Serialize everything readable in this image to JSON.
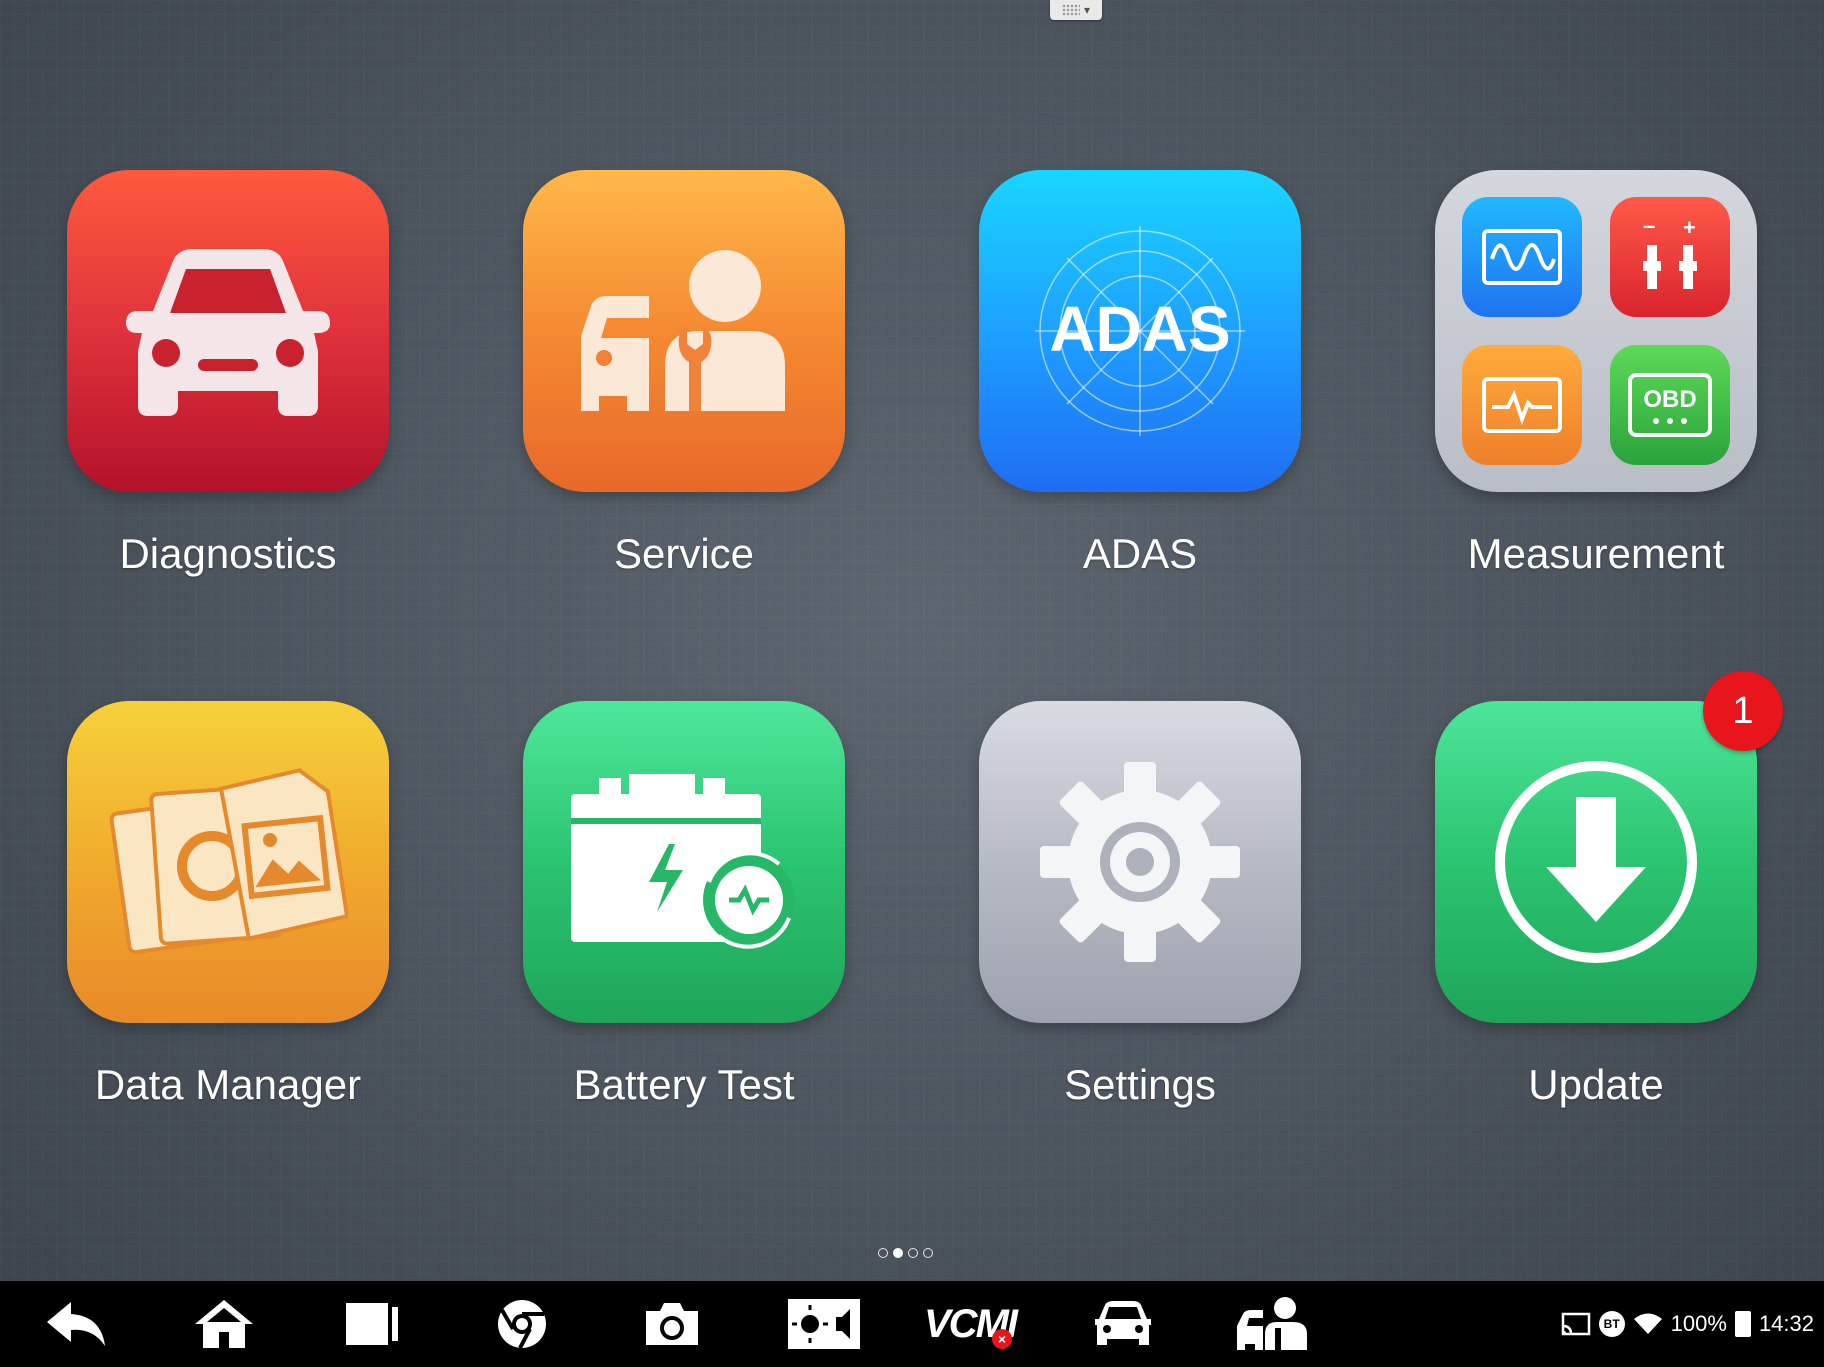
{
  "apps": {
    "diagnostics": {
      "label": "Diagnostics",
      "icon": "car-front-icon"
    },
    "service": {
      "label": "Service",
      "icon": "service-technician-icon"
    },
    "adas": {
      "label": "ADAS",
      "icon": "adas-icon",
      "icon_text": "ADAS"
    },
    "measurement": {
      "label": "Measurement",
      "icon": "measurement-folder-icon",
      "obd_text": "OBD"
    },
    "data_manager": {
      "label": "Data Manager",
      "icon": "data-manager-icon"
    },
    "battery_test": {
      "label": "Battery Test",
      "icon": "battery-test-icon"
    },
    "settings": {
      "label": "Settings",
      "icon": "gear-icon"
    },
    "update": {
      "label": "Update",
      "icon": "download-icon",
      "badge": "1"
    }
  },
  "pager": {
    "pages": 4,
    "active": 1
  },
  "taskbar": {
    "items": [
      "back-icon",
      "home-icon",
      "recent-apps-icon",
      "browser-icon",
      "camera-icon",
      "display-settings-icon",
      "vcmi-icon",
      "car-diagnostics-icon",
      "service-icon"
    ],
    "vcmi_text": "VCMI"
  },
  "status": {
    "battery": "100%",
    "time": "14:32",
    "bt": "BT"
  },
  "colors": {
    "diagnostics": "#e0323c",
    "service": "#f58a32",
    "adas": "#1e9bff",
    "battery_test": "#2bc471",
    "badge": "#e8161c"
  }
}
